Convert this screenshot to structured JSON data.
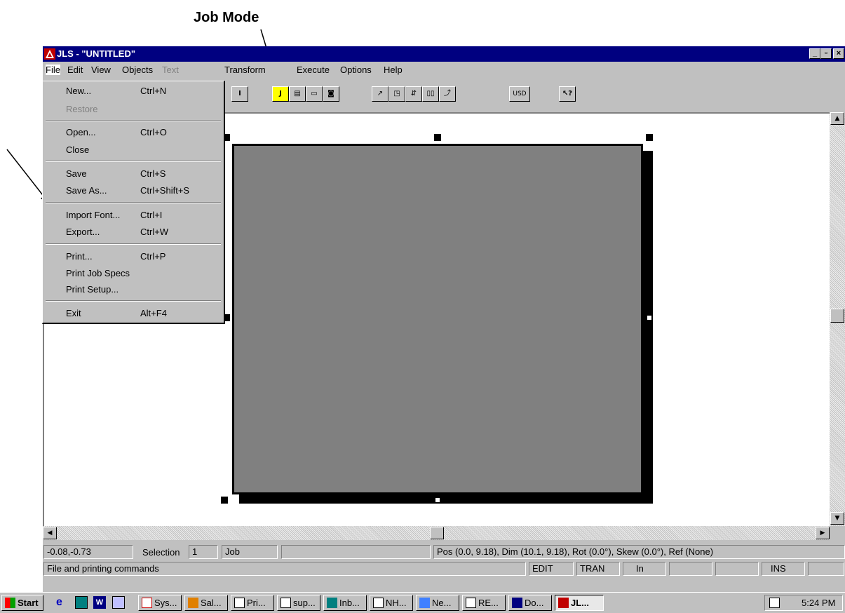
{
  "annotation": {
    "label": "Job Mode"
  },
  "window": {
    "title": "JLS - \"UNTITLED\"",
    "min": "_",
    "max": "▫",
    "close": "×"
  },
  "menubar": [
    "File",
    "Edit",
    "View",
    "Objects",
    "Text",
    "Transform",
    "Execute",
    "Options",
    "Help"
  ],
  "toolbar": {
    "usd": "USD"
  },
  "file_menu": [
    {
      "label": "New...",
      "shortcut": "Ctrl+N"
    },
    {
      "label": "Restore",
      "shortcut": ""
    },
    {
      "label": "Open...",
      "shortcut": "Ctrl+O"
    },
    {
      "label": "Close",
      "shortcut": ""
    },
    {
      "label": "Save",
      "shortcut": "Ctrl+S"
    },
    {
      "label": "Save As...",
      "shortcut": "Ctrl+Shift+S"
    },
    {
      "label": "Import Font...",
      "shortcut": "Ctrl+I"
    },
    {
      "label": "Export...",
      "shortcut": "Ctrl+W"
    },
    {
      "label": "Print...",
      "shortcut": "Ctrl+P"
    },
    {
      "label": "Print Job Specs",
      "shortcut": ""
    },
    {
      "label": "Print Setup...",
      "shortcut": ""
    },
    {
      "label": "Exit",
      "shortcut": "Alt+F4"
    }
  ],
  "status": {
    "coords": "-0.08,-0.73",
    "selection_label": "Selection",
    "selection_value": "1",
    "mode": "Job",
    "info": "Pos (0.0, 9.18), Dim (10.1, 9.18), Rot (0.0°), Skew (0.0°), Ref (None)",
    "help": "File and printing commands",
    "edit": "EDIT",
    "tran": "TRAN",
    "units": "In",
    "ins": "INS"
  },
  "taskbar": {
    "start": "Start",
    "items": [
      "Sys...",
      "Sal...",
      "Pri...",
      "sup...",
      "Inb...",
      "NH...",
      "Ne...",
      "RE...",
      "Do...",
      "JL..."
    ],
    "clock": "5:24 PM"
  },
  "colors": {
    "titlebar": "#000080",
    "face": "#c0c0c0",
    "shape": "#808080",
    "job_button": "#ffff00"
  }
}
